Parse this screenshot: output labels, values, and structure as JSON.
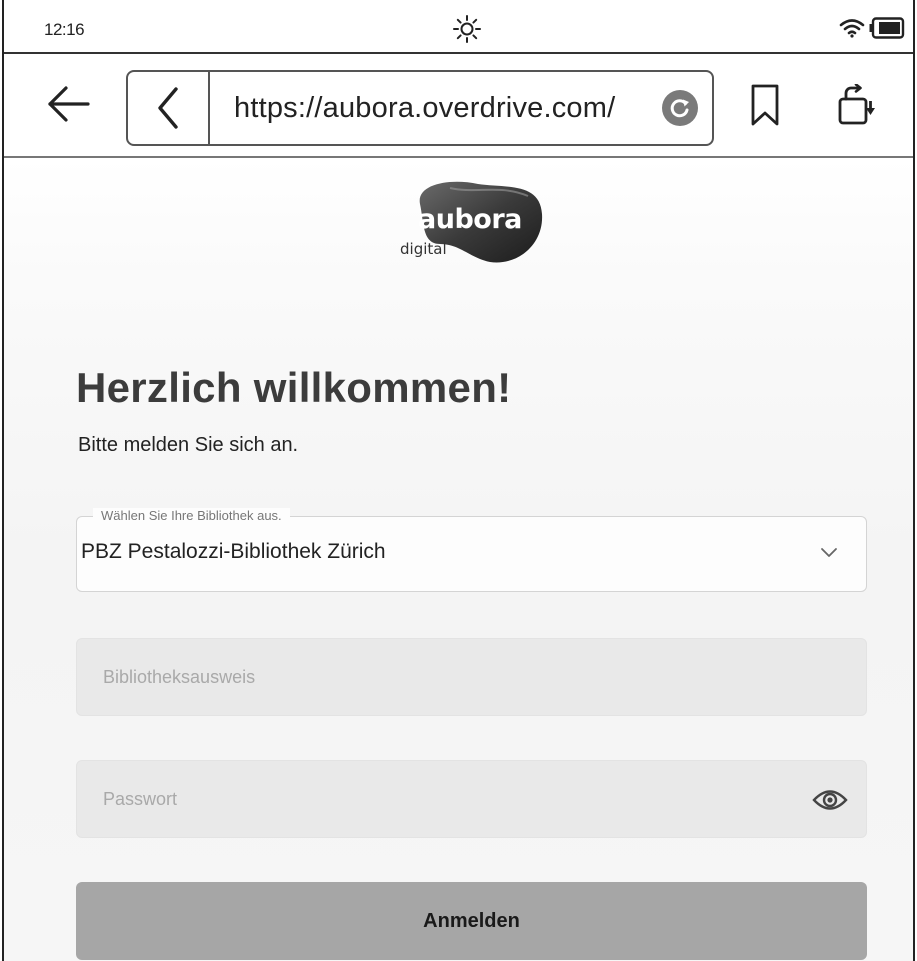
{
  "status_bar": {
    "time": "12:16",
    "icons": [
      "brightness-icon",
      "wifi-icon",
      "battery-icon"
    ]
  },
  "toolbar": {
    "url": "https://aubora.overdrive.com/",
    "icons": [
      "back-arrow-icon",
      "chevron-left-icon",
      "reload-icon",
      "bookmark-icon",
      "rotate-screen-icon"
    ]
  },
  "logo": {
    "brand": "aubora",
    "tagline": "digital"
  },
  "login": {
    "title": "Herzlich willkommen!",
    "subtitle": "Bitte melden Sie sich an.",
    "library_select": {
      "label": "Wählen Sie Ihre Bibliothek aus.",
      "value": "PBZ Pestalozzi-Bibliothek Zürich"
    },
    "card_field": {
      "placeholder": "Bibliotheksausweis",
      "value": ""
    },
    "password_field": {
      "placeholder": "Passwort",
      "value": ""
    },
    "submit_label": "Anmelden"
  },
  "colors": {
    "button_bg": "#a6a6a6",
    "field_bg": "#e9e9e9",
    "heading": "#3c3c3c"
  }
}
